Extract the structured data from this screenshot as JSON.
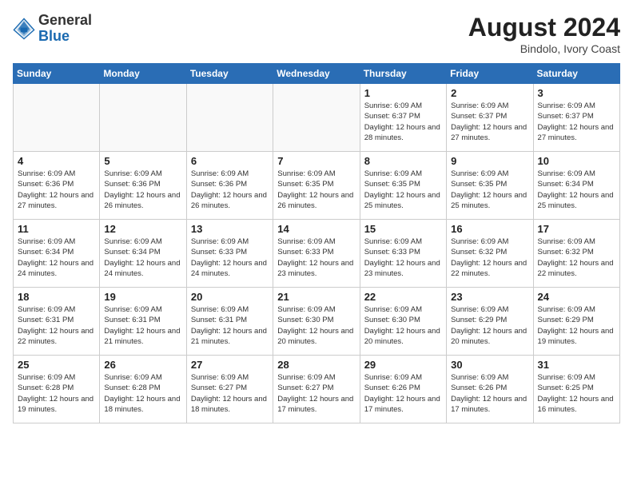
{
  "header": {
    "logo_general": "General",
    "logo_blue": "Blue",
    "month_title": "August 2024",
    "subtitle": "Bindolo, Ivory Coast"
  },
  "weekdays": [
    "Sunday",
    "Monday",
    "Tuesday",
    "Wednesday",
    "Thursday",
    "Friday",
    "Saturday"
  ],
  "weeks": [
    [
      {
        "day": "",
        "info": ""
      },
      {
        "day": "",
        "info": ""
      },
      {
        "day": "",
        "info": ""
      },
      {
        "day": "",
        "info": ""
      },
      {
        "day": "1",
        "info": "Sunrise: 6:09 AM\nSunset: 6:37 PM\nDaylight: 12 hours\nand 28 minutes."
      },
      {
        "day": "2",
        "info": "Sunrise: 6:09 AM\nSunset: 6:37 PM\nDaylight: 12 hours\nand 27 minutes."
      },
      {
        "day": "3",
        "info": "Sunrise: 6:09 AM\nSunset: 6:37 PM\nDaylight: 12 hours\nand 27 minutes."
      }
    ],
    [
      {
        "day": "4",
        "info": "Sunrise: 6:09 AM\nSunset: 6:36 PM\nDaylight: 12 hours\nand 27 minutes."
      },
      {
        "day": "5",
        "info": "Sunrise: 6:09 AM\nSunset: 6:36 PM\nDaylight: 12 hours\nand 26 minutes."
      },
      {
        "day": "6",
        "info": "Sunrise: 6:09 AM\nSunset: 6:36 PM\nDaylight: 12 hours\nand 26 minutes."
      },
      {
        "day": "7",
        "info": "Sunrise: 6:09 AM\nSunset: 6:35 PM\nDaylight: 12 hours\nand 26 minutes."
      },
      {
        "day": "8",
        "info": "Sunrise: 6:09 AM\nSunset: 6:35 PM\nDaylight: 12 hours\nand 25 minutes."
      },
      {
        "day": "9",
        "info": "Sunrise: 6:09 AM\nSunset: 6:35 PM\nDaylight: 12 hours\nand 25 minutes."
      },
      {
        "day": "10",
        "info": "Sunrise: 6:09 AM\nSunset: 6:34 PM\nDaylight: 12 hours\nand 25 minutes."
      }
    ],
    [
      {
        "day": "11",
        "info": "Sunrise: 6:09 AM\nSunset: 6:34 PM\nDaylight: 12 hours\nand 24 minutes."
      },
      {
        "day": "12",
        "info": "Sunrise: 6:09 AM\nSunset: 6:34 PM\nDaylight: 12 hours\nand 24 minutes."
      },
      {
        "day": "13",
        "info": "Sunrise: 6:09 AM\nSunset: 6:33 PM\nDaylight: 12 hours\nand 24 minutes."
      },
      {
        "day": "14",
        "info": "Sunrise: 6:09 AM\nSunset: 6:33 PM\nDaylight: 12 hours\nand 23 minutes."
      },
      {
        "day": "15",
        "info": "Sunrise: 6:09 AM\nSunset: 6:33 PM\nDaylight: 12 hours\nand 23 minutes."
      },
      {
        "day": "16",
        "info": "Sunrise: 6:09 AM\nSunset: 6:32 PM\nDaylight: 12 hours\nand 22 minutes."
      },
      {
        "day": "17",
        "info": "Sunrise: 6:09 AM\nSunset: 6:32 PM\nDaylight: 12 hours\nand 22 minutes."
      }
    ],
    [
      {
        "day": "18",
        "info": "Sunrise: 6:09 AM\nSunset: 6:31 PM\nDaylight: 12 hours\nand 22 minutes."
      },
      {
        "day": "19",
        "info": "Sunrise: 6:09 AM\nSunset: 6:31 PM\nDaylight: 12 hours\nand 21 minutes."
      },
      {
        "day": "20",
        "info": "Sunrise: 6:09 AM\nSunset: 6:31 PM\nDaylight: 12 hours\nand 21 minutes."
      },
      {
        "day": "21",
        "info": "Sunrise: 6:09 AM\nSunset: 6:30 PM\nDaylight: 12 hours\nand 20 minutes."
      },
      {
        "day": "22",
        "info": "Sunrise: 6:09 AM\nSunset: 6:30 PM\nDaylight: 12 hours\nand 20 minutes."
      },
      {
        "day": "23",
        "info": "Sunrise: 6:09 AM\nSunset: 6:29 PM\nDaylight: 12 hours\nand 20 minutes."
      },
      {
        "day": "24",
        "info": "Sunrise: 6:09 AM\nSunset: 6:29 PM\nDaylight: 12 hours\nand 19 minutes."
      }
    ],
    [
      {
        "day": "25",
        "info": "Sunrise: 6:09 AM\nSunset: 6:28 PM\nDaylight: 12 hours\nand 19 minutes."
      },
      {
        "day": "26",
        "info": "Sunrise: 6:09 AM\nSunset: 6:28 PM\nDaylight: 12 hours\nand 18 minutes."
      },
      {
        "day": "27",
        "info": "Sunrise: 6:09 AM\nSunset: 6:27 PM\nDaylight: 12 hours\nand 18 minutes."
      },
      {
        "day": "28",
        "info": "Sunrise: 6:09 AM\nSunset: 6:27 PM\nDaylight: 12 hours\nand 17 minutes."
      },
      {
        "day": "29",
        "info": "Sunrise: 6:09 AM\nSunset: 6:26 PM\nDaylight: 12 hours\nand 17 minutes."
      },
      {
        "day": "30",
        "info": "Sunrise: 6:09 AM\nSunset: 6:26 PM\nDaylight: 12 hours\nand 17 minutes."
      },
      {
        "day": "31",
        "info": "Sunrise: 6:09 AM\nSunset: 6:25 PM\nDaylight: 12 hours\nand 16 minutes."
      }
    ]
  ]
}
